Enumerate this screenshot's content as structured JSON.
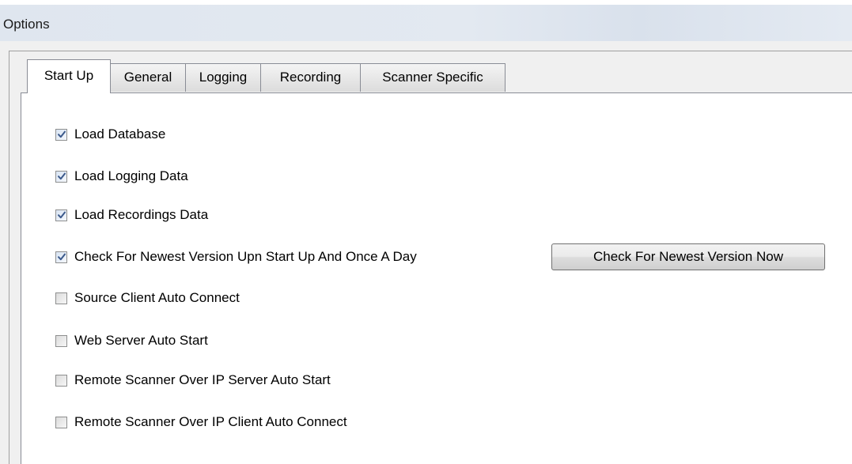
{
  "window": {
    "title": "Options"
  },
  "tabs": [
    {
      "label": "Start Up",
      "active": true
    },
    {
      "label": "General",
      "active": false
    },
    {
      "label": "Logging",
      "active": false
    },
    {
      "label": "Recording",
      "active": false
    },
    {
      "label": "Scanner Specific",
      "active": false
    }
  ],
  "startup": {
    "options": [
      {
        "label": "Load Database",
        "checked": true
      },
      {
        "label": "Load Logging Data",
        "checked": true
      },
      {
        "label": "Load Recordings Data",
        "checked": true
      },
      {
        "label": "Check For Newest Version Upn Start Up And Once A Day",
        "checked": true
      },
      {
        "label": "Source Client Auto Connect",
        "checked": false
      },
      {
        "label": "Web Server Auto Start",
        "checked": false
      },
      {
        "label": "Remote Scanner Over IP Server Auto Start",
        "checked": false
      },
      {
        "label": "Remote Scanner Over IP Client Auto Connect",
        "checked": false
      }
    ],
    "check_now_button": "Check For Newest Version Now"
  },
  "colors": {
    "check_mark": "#3c5a8c",
    "title_bar": "#dfe6ef",
    "window_face": "#f0f0f0"
  }
}
